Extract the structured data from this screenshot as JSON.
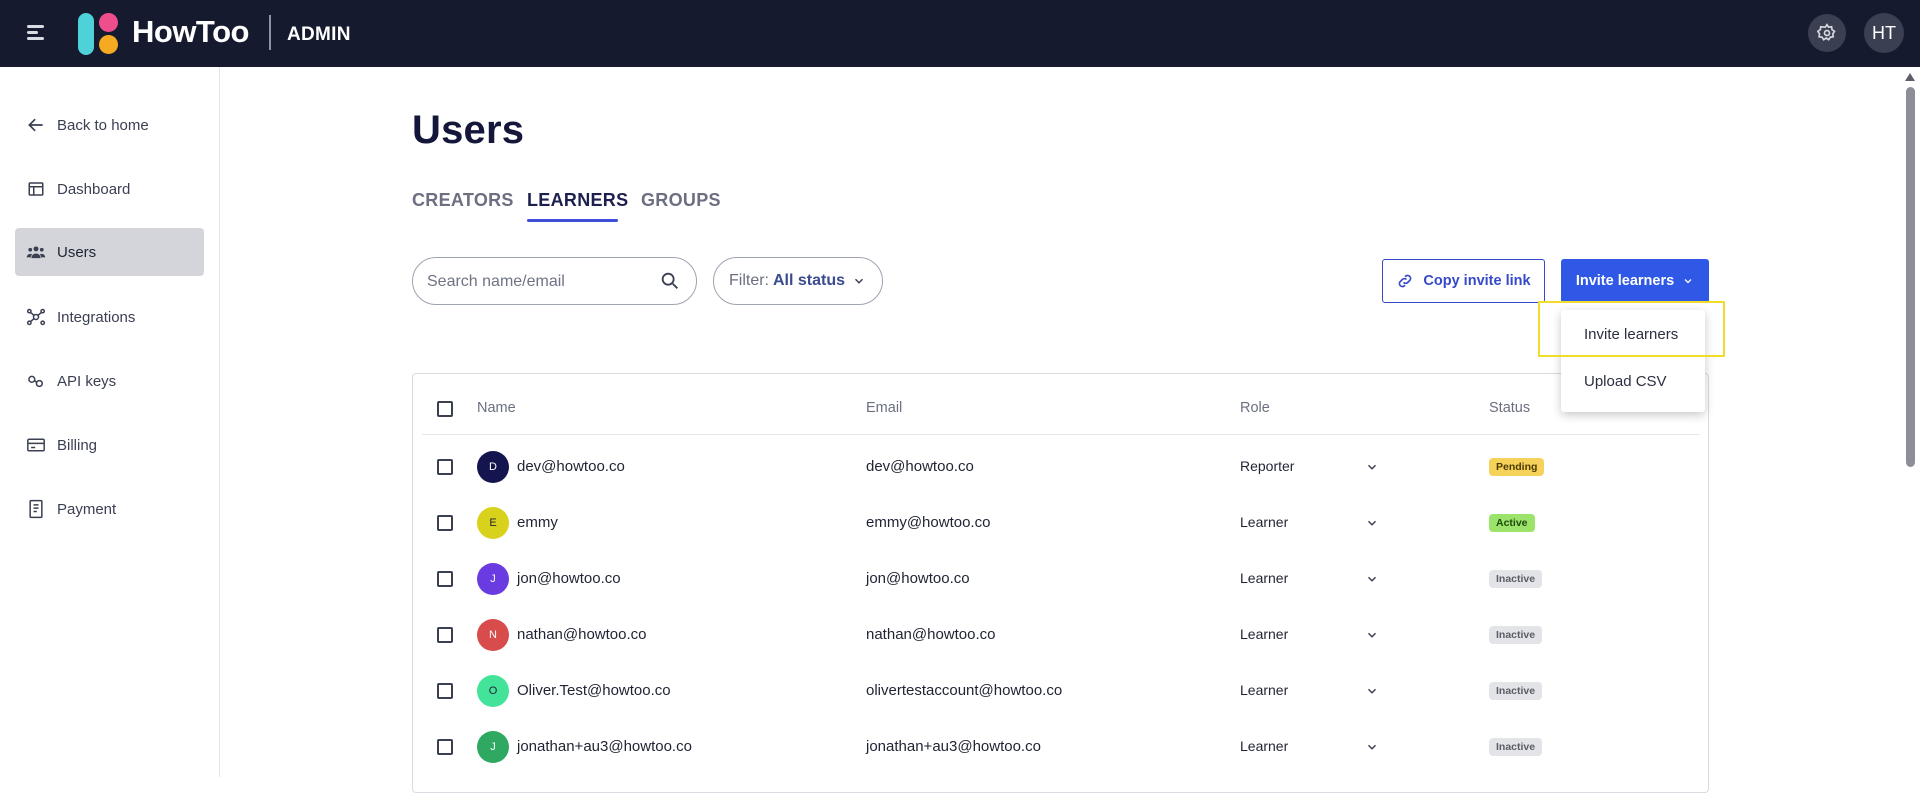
{
  "header": {
    "brand": "HowToo",
    "section": "ADMIN",
    "avatar_initials": "HT",
    "icons": [
      "menu-icon",
      "gear-icon"
    ]
  },
  "sidebar": {
    "items": [
      {
        "label": "Back to home",
        "icon": "arrow-left-icon"
      },
      {
        "label": "Dashboard",
        "icon": "dashboard-icon"
      },
      {
        "label": "Users",
        "icon": "users-icon",
        "active": true
      },
      {
        "label": "Integrations",
        "icon": "integrations-icon"
      },
      {
        "label": "API keys",
        "icon": "key-icon"
      },
      {
        "label": "Billing",
        "icon": "billing-icon"
      },
      {
        "label": "Payment",
        "icon": "receipt-icon"
      }
    ]
  },
  "main": {
    "title": "Users",
    "tabs": [
      {
        "label": "CREATORS"
      },
      {
        "label": "LEARNERS",
        "active": true
      },
      {
        "label": "GROUPS"
      }
    ],
    "search": {
      "placeholder": "Search name/email",
      "value": ""
    },
    "filter": {
      "label": "Filter:",
      "value": "All status"
    },
    "copy_invite_label": "Copy invite link",
    "invite_label": "Invite learners",
    "invite_menu": [
      "Invite learners",
      "Upload CSV"
    ]
  },
  "table": {
    "headers": [
      "Name",
      "Email",
      "Role",
      "Status"
    ],
    "rows": [
      {
        "initial": "D",
        "avatar_color": "#14154f",
        "name": "dev@howtoo.co",
        "email": "dev@howtoo.co",
        "role": "Reporter",
        "status": "Pending"
      },
      {
        "initial": "E",
        "avatar_color": "#d9d21c",
        "name": "emmy",
        "email": "emmy@howtoo.co",
        "role": "Learner",
        "status": "Active"
      },
      {
        "initial": "J",
        "avatar_color": "#6a3be0",
        "name": "jon@howtoo.co",
        "email": "jon@howtoo.co",
        "role": "Learner",
        "status": "Inactive"
      },
      {
        "initial": "N",
        "avatar_color": "#d84c4c",
        "name": "nathan@howtoo.co",
        "email": "nathan@howtoo.co",
        "role": "Learner",
        "status": "Inactive"
      },
      {
        "initial": "O",
        "avatar_color": "#43e39a",
        "name": "Oliver.Test@howtoo.co",
        "email": "olivertestaccount@howtoo.co",
        "role": "Learner",
        "status": "Inactive"
      },
      {
        "initial": "J",
        "avatar_color": "#2fa862",
        "name": "jonathan+au3@howtoo.co",
        "email": "jonathan+au3@howtoo.co",
        "role": "Learner",
        "status": "Inactive"
      }
    ]
  },
  "colors": {
    "topbar": "#161a2e",
    "accent": "#2f58e6",
    "pending": "#f7d25a",
    "active": "#9be36b",
    "inactive": "#e3e4e8"
  }
}
